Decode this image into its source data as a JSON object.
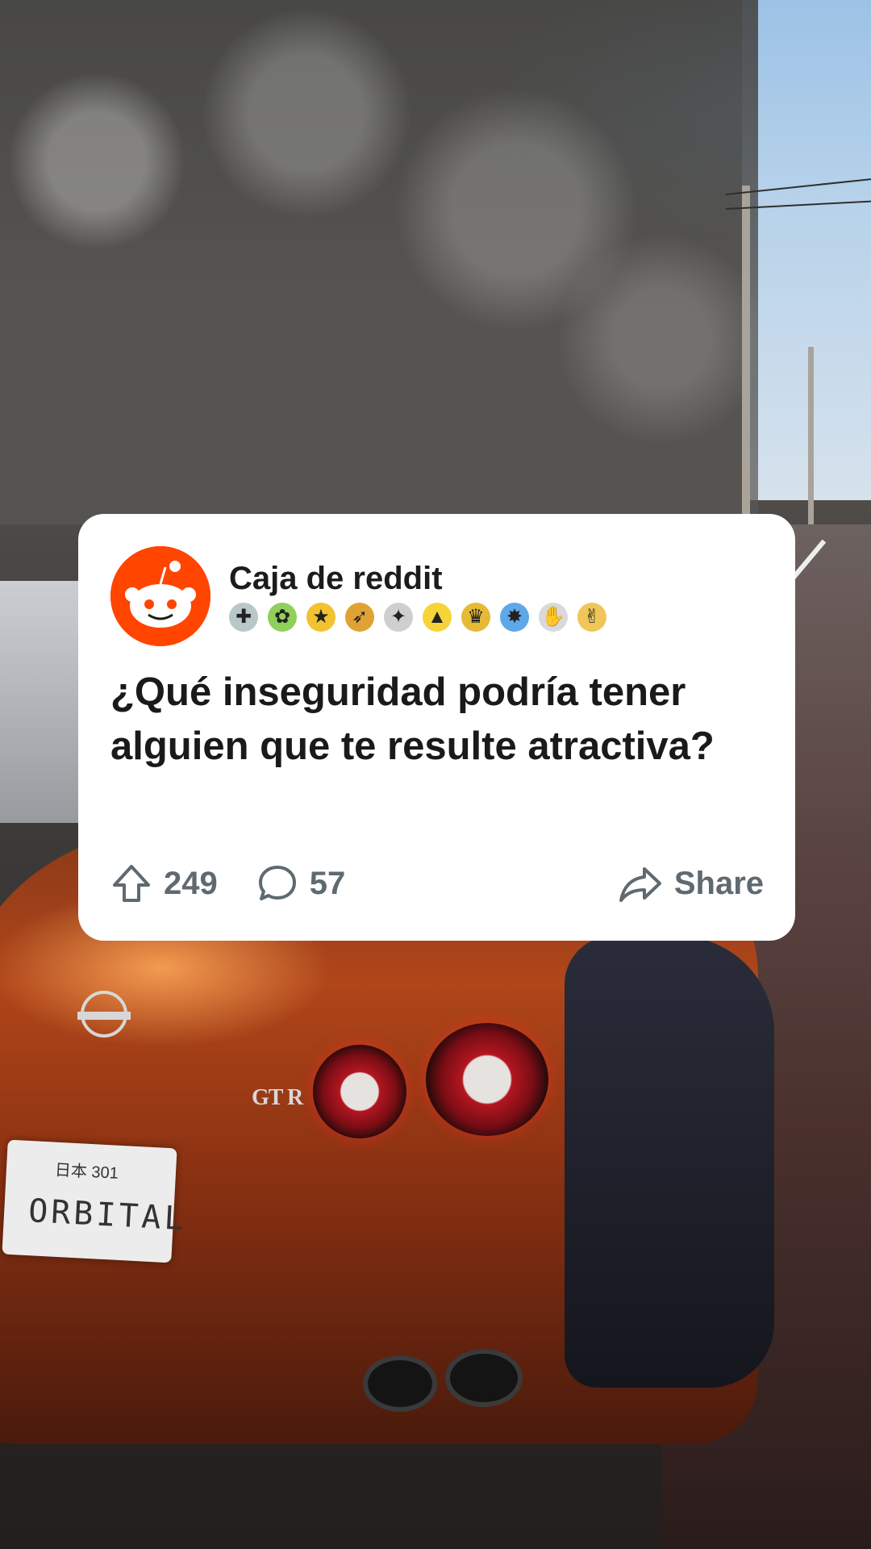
{
  "post": {
    "author": "Caja de reddit",
    "title": "¿Qué inseguridad podría tener alguien que te resulte atractiva?",
    "upvotes": "249",
    "comments": "57",
    "share_label": "Share",
    "awards": [
      {
        "icon": "medal-icon",
        "glyph": "✚",
        "color": "#b9c7c9"
      },
      {
        "icon": "clover-icon",
        "glyph": "✿",
        "color": "#8fcf5a"
      },
      {
        "icon": "star-icon",
        "glyph": "★",
        "color": "#f2c230"
      },
      {
        "icon": "rocket-icon",
        "glyph": "➶",
        "color": "#e0a235"
      },
      {
        "icon": "mask-icon",
        "glyph": "✦",
        "color": "#cfcfcf"
      },
      {
        "icon": "up-arrow-award-icon",
        "glyph": "▲",
        "color": "#f5d43a"
      },
      {
        "icon": "trophy-icon",
        "glyph": "♛",
        "color": "#e6b936"
      },
      {
        "icon": "burst-icon",
        "glyph": "✸",
        "color": "#5fa8e8"
      },
      {
        "icon": "clap-icon",
        "glyph": "✋",
        "color": "#d9d9d9"
      },
      {
        "icon": "thumbs-up-icon",
        "glyph": "✌",
        "color": "#f0c65a"
      }
    ]
  },
  "background": {
    "plate_top": "日本 301",
    "plate_main": "ORBITAL",
    "badge": "GT R"
  },
  "colors": {
    "brand": "#ff4500",
    "action_gray": "#5f6a70",
    "text_dark": "#1a1a1b"
  }
}
